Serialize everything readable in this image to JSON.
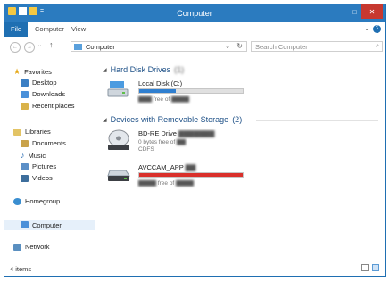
{
  "window": {
    "title": "Computer"
  },
  "ribbon": {
    "tabs": [
      "File",
      "Computer",
      "View"
    ]
  },
  "nav": {
    "address": "Computer",
    "search_placeholder": "Search Computer"
  },
  "sidebar": {
    "favorites": "Favorites",
    "fav_items": [
      "Desktop",
      "Downloads",
      "Recent places"
    ],
    "libraries": "Libraries",
    "lib_items": [
      "Documents",
      "Music",
      "Pictures",
      "Videos"
    ],
    "homegroup": "Homegroup",
    "computer": "Computer",
    "network": "Network"
  },
  "content": {
    "hdd_group": "Hard Disk Drives",
    "hdd_count": "(1)",
    "local_disk": {
      "name": "Local Disk (C:)",
      "free_text": "free of",
      "usage": 0.35
    },
    "removable_group": "Devices with Removable Storage",
    "removable_count": "(2)",
    "bd_drive": {
      "name": "BD-RE Drive",
      "line1": "0 bytes free of",
      "line2": "CDFS"
    },
    "avcam": {
      "name": "AVCCAM_APP",
      "free_text": "free of",
      "usage": 1.0
    }
  },
  "status": {
    "items": "4 items"
  },
  "colors": {
    "titlebar": "#2b7bbf",
    "accent": "#1f6fb2",
    "local_bar": "#2f7fd0",
    "avcam_bar": "#d9302b"
  }
}
